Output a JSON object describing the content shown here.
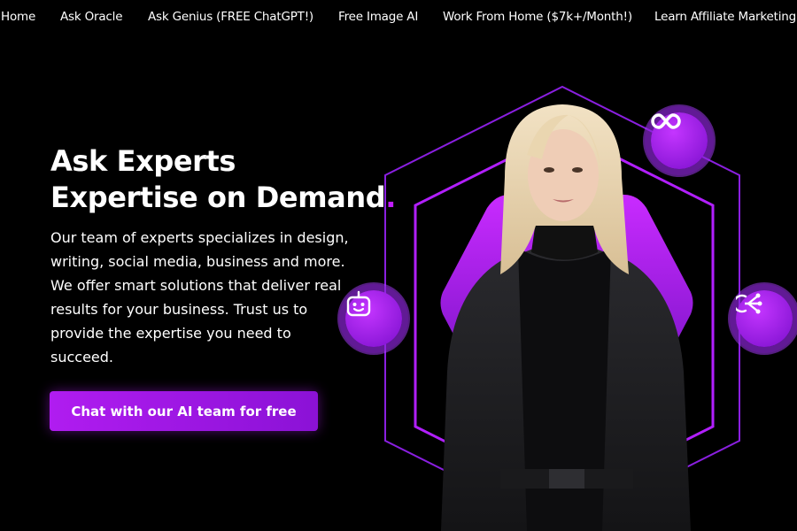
{
  "nav": {
    "items": [
      {
        "label": "Home"
      },
      {
        "label": "Ask Oracle"
      },
      {
        "label": "Ask Genius (FREE ChatGPT!)"
      },
      {
        "label": "Free Image AI"
      },
      {
        "label": "Work From Home ($7k+/Month!)"
      },
      {
        "label": "Learn Affiliate Marketing"
      }
    ]
  },
  "hero": {
    "title_line1": "Ask Experts",
    "title_line2": "Expertise on Demand",
    "title_dot": ".",
    "description": "Our team of experts specializes in design, writing, social media, business and more. We offer smart solutions that deliver real results for your business. Trust us to provide the expertise you need to succeed.",
    "cta_label": "Chat with our AI team for free"
  },
  "icons": {
    "top": "infinity-icon",
    "left": "robot-icon",
    "right": "network-icon"
  },
  "colors": {
    "background": "#000000",
    "accent": "#b01cf0",
    "accent_dark": "#7a0fcc"
  }
}
